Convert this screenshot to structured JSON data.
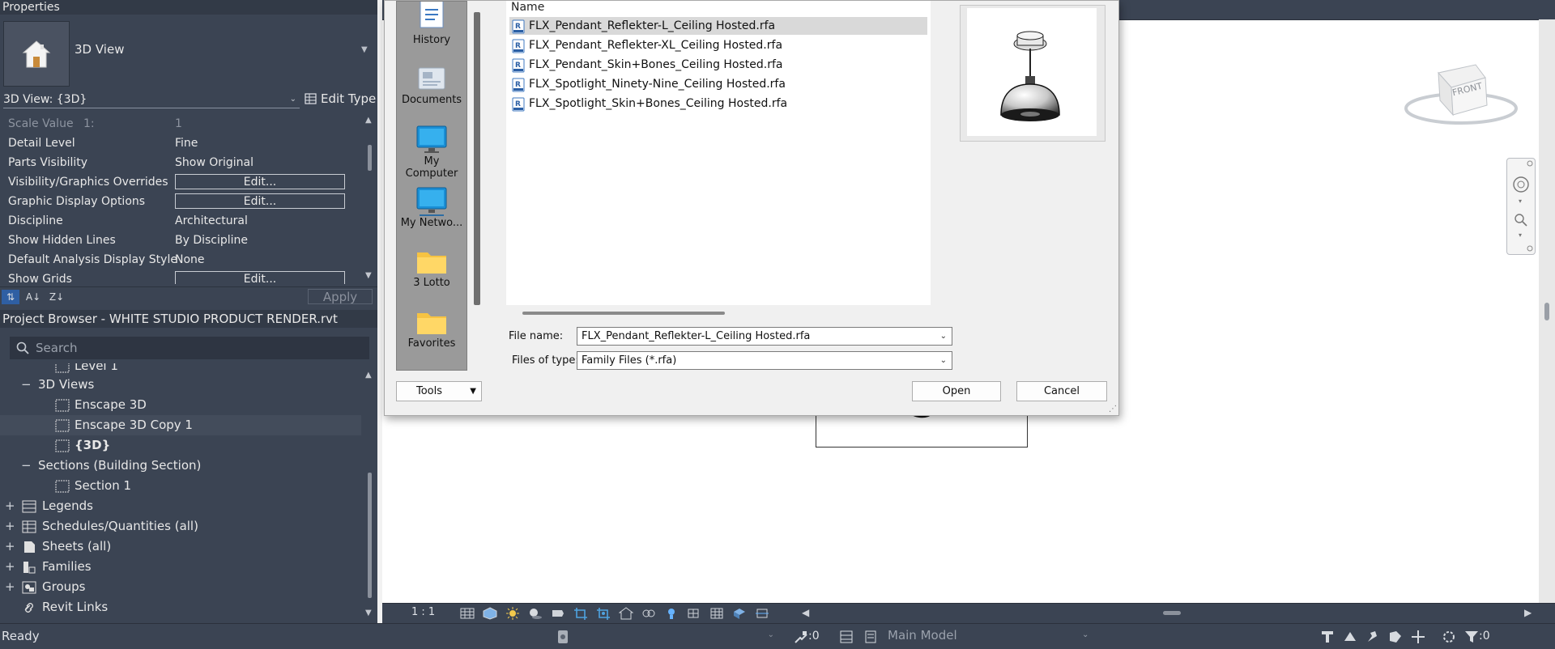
{
  "properties": {
    "header": "Properties",
    "type_name": "3D View",
    "instance_label": "3D View: {3D}",
    "edit_type_label": "Edit Type",
    "apply_label": "Apply",
    "rows": [
      {
        "key": "Scale Value",
        "key_suffix": "1:",
        "value": "1"
      },
      {
        "key": "Detail Level",
        "value": "Fine"
      },
      {
        "key": "Parts Visibility",
        "value": "Show Original"
      },
      {
        "key": "Visibility/Graphics Overrides",
        "button": "Edit..."
      },
      {
        "key": "Graphic Display Options",
        "button": "Edit..."
      },
      {
        "key": "Discipline",
        "value": "Architectural"
      },
      {
        "key": "Show Hidden Lines",
        "value": "By Discipline"
      },
      {
        "key": "Default Analysis Display Style",
        "value": "None"
      },
      {
        "key": "Show Grids",
        "button": "Edit..."
      }
    ]
  },
  "project_browser": {
    "header": "Project Browser - WHITE STUDIO PRODUCT RENDER.rvt",
    "search_placeholder": "Search",
    "nodes": [
      {
        "label": "Level 1"
      },
      {
        "label": "3D Views",
        "toggle": "−"
      },
      {
        "label": "Enscape 3D"
      },
      {
        "label": "Enscape 3D Copy 1"
      },
      {
        "label": "{3D}"
      },
      {
        "label": "Sections (Building Section)",
        "toggle": "−"
      },
      {
        "label": "Section 1"
      },
      {
        "label": "Legends",
        "toggle": "+"
      },
      {
        "label": "Schedules/Quantities (all)",
        "toggle": "+"
      },
      {
        "label": "Sheets (all)",
        "toggle": "+"
      },
      {
        "label": "Families",
        "toggle": "+"
      },
      {
        "label": "Groups",
        "toggle": "+"
      },
      {
        "label": "Revit Links"
      }
    ]
  },
  "viewport": {
    "scale": "1 : 1",
    "viewcube_face": "FRONT"
  },
  "status": {
    "text": "Ready",
    "count_a": ":0",
    "count_b": ":0",
    "design_option": "Main Model"
  },
  "dialog": {
    "places": [
      "History",
      "Documents",
      "My Computer",
      "My Netwo...",
      "3 Lotto",
      "Favorites"
    ],
    "list_header": "Name",
    "files": [
      "FLX_Pendant_Reflekter-L_Ceiling Hosted.rfa",
      "FLX_Pendant_Reflekter-XL_Ceiling Hosted.rfa",
      "FLX_Pendant_Skin+Bones_Ceiling Hosted.rfa",
      "FLX_Spotlight_Ninety-Nine_Ceiling Hosted.rfa",
      "FLX_Spotlight_Skin+Bones_Ceiling Hosted.rfa"
    ],
    "file_name_label": "File name:",
    "file_name_value": "FLX_Pendant_Reflekter-L_Ceiling Hosted.rfa",
    "file_type_label": "Files of type:",
    "file_type_value": "Family Files  (*.rfa)",
    "tools_label": "Tools",
    "open_label": "Open",
    "cancel_label": "Cancel"
  },
  "colors": {
    "panel_bg": "#3b4453",
    "panel_header": "#323a47",
    "dialog_bg": "#f0f0f0",
    "selection": "#d9d9d9"
  }
}
